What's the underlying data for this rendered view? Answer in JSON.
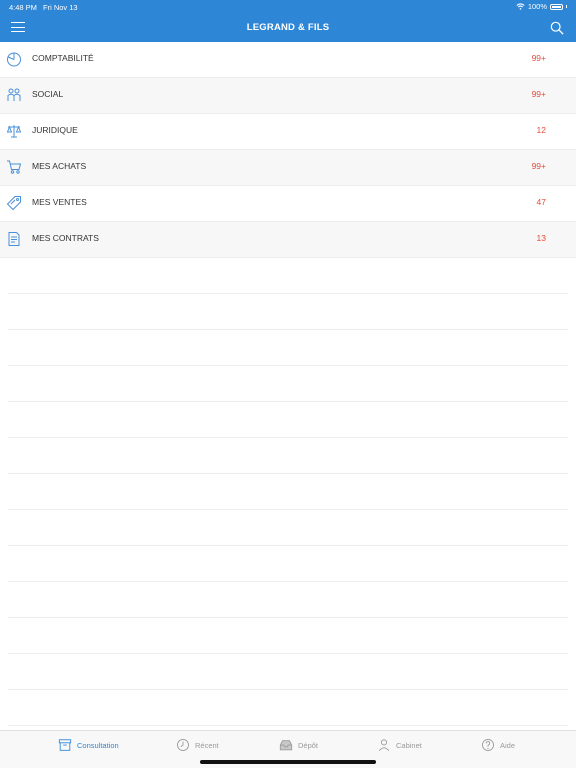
{
  "status_bar": {
    "time": "4:48 PM",
    "date": "Fri Nov 13",
    "battery": "100%"
  },
  "header": {
    "title": "LEGRAND & FILS",
    "menu_icon": "hamburger-icon",
    "search_icon": "search-icon"
  },
  "categories": [
    {
      "label": "COMPTABILITÉ",
      "count": "99+",
      "icon": "pie-chart-icon"
    },
    {
      "label": "SOCIAL",
      "count": "99+",
      "icon": "people-icon"
    },
    {
      "label": "JURIDIQUE",
      "count": "12",
      "icon": "scales-icon"
    },
    {
      "label": "MES ACHATS",
      "count": "99+",
      "icon": "cart-icon"
    },
    {
      "label": "MES VENTES",
      "count": "47",
      "icon": "tag-icon"
    },
    {
      "label": "MES CONTRATS",
      "count": "13",
      "icon": "document-icon"
    }
  ],
  "tabs": [
    {
      "label": "Consultation",
      "icon": "archive-box-icon",
      "active": true
    },
    {
      "label": "Récent",
      "icon": "clock-icon",
      "active": false
    },
    {
      "label": "Dépôt",
      "icon": "inbox-tray-icon",
      "active": false
    },
    {
      "label": "Cabinet",
      "icon": "person-icon",
      "active": false
    },
    {
      "label": "Aide",
      "icon": "help-circle-icon",
      "active": false
    }
  ],
  "colors": {
    "header": "#2e86d6",
    "accent": "#2e86d6",
    "count": "#e74c3c",
    "tab_inactive": "#9a9a9a"
  }
}
